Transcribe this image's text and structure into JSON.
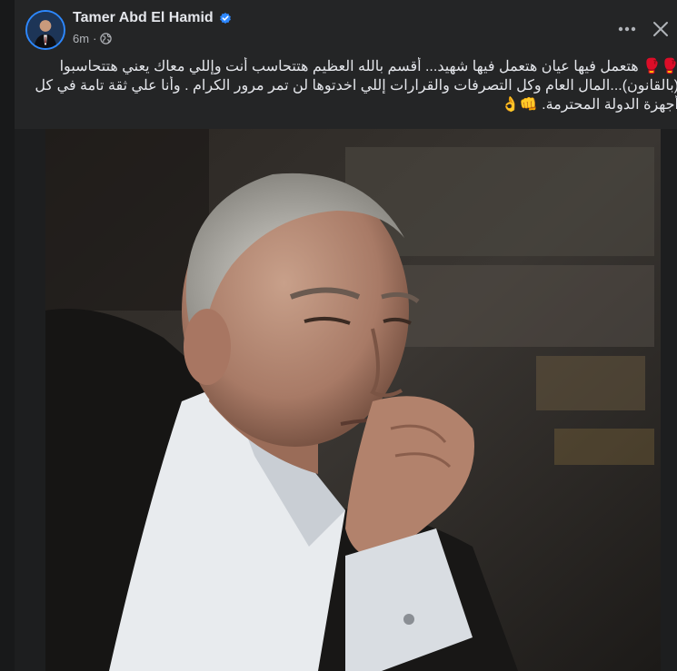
{
  "post": {
    "author": "Tamer Abd El Hamid",
    "time": "6m",
    "separator": "·",
    "privacy_icon": "globe-icon",
    "text_lines": [
      "🥊🥊 هتعمل فيها عيان هتعمل فيها شهيد... أقسم بالله العظيم هتتحاسب أنت وإللي معاك يعني هتتحاسبوا",
      "(بالقانون)...المال العام وكل التصرفات والقرارات إللي اخدتوها لن تمر مرور الكرام . وأنا علي ثقة تامة في كل",
      "أجهزة الدولة المحترمة. 👊👌"
    ]
  },
  "header": {
    "more_icon": "more-options-icon",
    "close_icon": "close-icon",
    "verified_icon": "verified-badge-icon"
  },
  "colors": {
    "background": "#18191a",
    "card": "#242526",
    "text_primary": "#e4e6eb",
    "text_secondary": "#b0b3b8",
    "verified": "#2d88ff"
  }
}
